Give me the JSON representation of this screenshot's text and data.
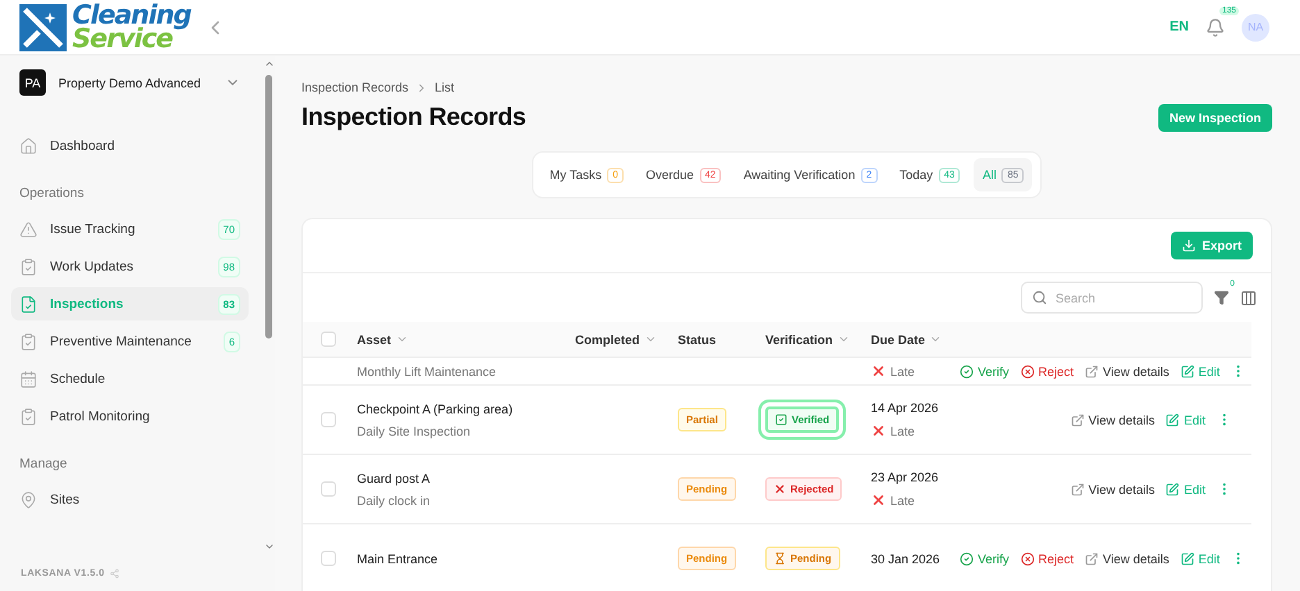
{
  "logo": {
    "line_1": "Cleaning",
    "line_2": "Service"
  },
  "header": {
    "language": "EN",
    "notifications": "135",
    "avatar": "NA"
  },
  "sidebar": {
    "workspace": {
      "initials": "PA",
      "name": "Property Demo Advanced"
    },
    "items": [
      {
        "kind": "link",
        "label": "Dashboard",
        "selected": false
      },
      {
        "kind": "section",
        "label": "Operations"
      },
      {
        "kind": "link",
        "label": "Issue Tracking",
        "count": "70",
        "selected": false
      },
      {
        "kind": "link",
        "label": "Work Updates",
        "count": "98",
        "selected": false
      },
      {
        "kind": "link",
        "label": "Inspections",
        "count": "83",
        "selected": true
      },
      {
        "kind": "link",
        "label": "Preventive Maintenance",
        "count": "6",
        "selected": false
      },
      {
        "kind": "link",
        "label": "Schedule",
        "selected": false
      },
      {
        "kind": "link",
        "label": "Patrol Monitoring",
        "selected": false
      },
      {
        "kind": "section",
        "label": "Manage"
      },
      {
        "kind": "link",
        "label": "Sites",
        "selected": false
      }
    ],
    "version": "LAKSANA V1.5.0"
  },
  "breadcrumb": [
    "Inspection Records",
    "List"
  ],
  "title": "Inspection Records",
  "new_button": "New Inspection",
  "filter_tabs": [
    {
      "label": "My Tasks",
      "count": "0",
      "color": "#f59e0b",
      "selected": false
    },
    {
      "label": "Overdue",
      "count": "42",
      "color": "#ef4444",
      "selected": false
    },
    {
      "label": "Awaiting Verification",
      "count": "2",
      "color": "#3b82f6",
      "selected": false
    },
    {
      "label": "Today",
      "count": "43",
      "color": "#10b981",
      "selected": false
    },
    {
      "label": "All",
      "count": "85",
      "color": "#6b7280",
      "selected": true
    }
  ],
  "export_button": "Export",
  "search": {
    "placeholder": "Search"
  },
  "filter_count": "0",
  "table": {
    "select_all_checked": false,
    "columns": [
      {
        "label": "Asset",
        "sortable": true
      },
      {
        "label": "Completed",
        "sortable": true
      },
      {
        "label": "Status",
        "sortable": false
      },
      {
        "label": "Verification",
        "sortable": true
      },
      {
        "label": "Due Date",
        "sortable": true
      }
    ],
    "rows": [
      {
        "kind": "partial",
        "subtitle": "Monthly Lift Maintenance",
        "due_note": "Late",
        "actions": [
          {
            "kind": "verify",
            "label": "Verify"
          },
          {
            "kind": "reject",
            "label": "Reject"
          },
          {
            "kind": "view",
            "label": "View details"
          },
          {
            "kind": "edit",
            "label": "Edit"
          }
        ]
      },
      {
        "kind": "full",
        "checked": false,
        "title": "Checkpoint A (Parking area)",
        "subtitle": "Daily Site Inspection",
        "status": {
          "kind": "partial",
          "label": "Partial"
        },
        "verification": {
          "kind": "verified",
          "label": "Verified",
          "highlighted": true
        },
        "due": "14 Apr 2026",
        "due_note": "Late",
        "actions": [
          {
            "kind": "view",
            "label": "View details"
          },
          {
            "kind": "edit",
            "label": "Edit"
          }
        ]
      },
      {
        "kind": "full",
        "checked": false,
        "title": "Guard post A",
        "subtitle": "Daily clock in",
        "status": {
          "kind": "pending",
          "label": "Pending"
        },
        "verification": {
          "kind": "rejected",
          "label": "Rejected",
          "highlighted": false
        },
        "due": "23 Apr 2026",
        "due_note": "Late",
        "actions": [
          {
            "kind": "view",
            "label": "View details"
          },
          {
            "kind": "edit",
            "label": "Edit"
          }
        ]
      },
      {
        "kind": "full",
        "checked": false,
        "title": "Main Entrance",
        "status": {
          "kind": "pending",
          "label": "Pending"
        },
        "verification": {
          "kind": "pending",
          "label": "Pending",
          "highlighted": false
        },
        "due": "30 Jan 2026",
        "actions": [
          {
            "kind": "verify",
            "label": "Verify"
          },
          {
            "kind": "reject",
            "label": "Reject"
          },
          {
            "kind": "view",
            "label": "View details"
          },
          {
            "kind": "edit",
            "label": "Edit"
          }
        ]
      }
    ]
  }
}
